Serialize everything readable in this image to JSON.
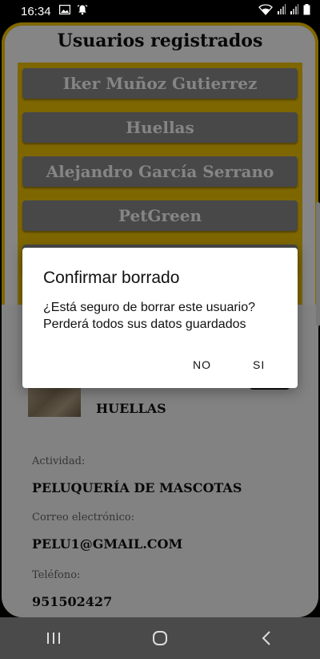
{
  "status_bar": {
    "time": "16:34",
    "icons_left": [
      "image-icon",
      "alarm-bell-icon"
    ],
    "icons_right": [
      "wifi-icon",
      "signal-icon",
      "signal-icon",
      "battery-icon"
    ]
  },
  "header": {
    "title": "Usuarios registrados"
  },
  "users": [
    {
      "label": "Iker Muñoz Gutierrez"
    },
    {
      "label": "Huellas"
    },
    {
      "label": "Alejandro García Serrano"
    },
    {
      "label": "PetGreen"
    }
  ],
  "detail": {
    "business_name": "HUELLAS",
    "activity_label": "Actividad:",
    "activity_value": "PELUQUERÍA DE MASCOTAS",
    "email_label": "Correo electrónico:",
    "email_value": "PELU1@GMAIL.COM",
    "phone_label": "Teléfono:",
    "phone_value": "951502427"
  },
  "dialog": {
    "title": "Confirmar borrado",
    "message_line1": "¿Está seguro de borrar este usuario?",
    "message_line2": "Perderá todos sus datos guardados",
    "no_label": "NO",
    "yes_label": "SI"
  },
  "nav": {
    "icons": [
      "recent-apps-icon",
      "home-icon",
      "back-icon"
    ]
  },
  "colors": {
    "accent": "#f6c500",
    "button_gray": "#8a8a8a",
    "scrim": "rgba(0,0,0,0.48)"
  }
}
